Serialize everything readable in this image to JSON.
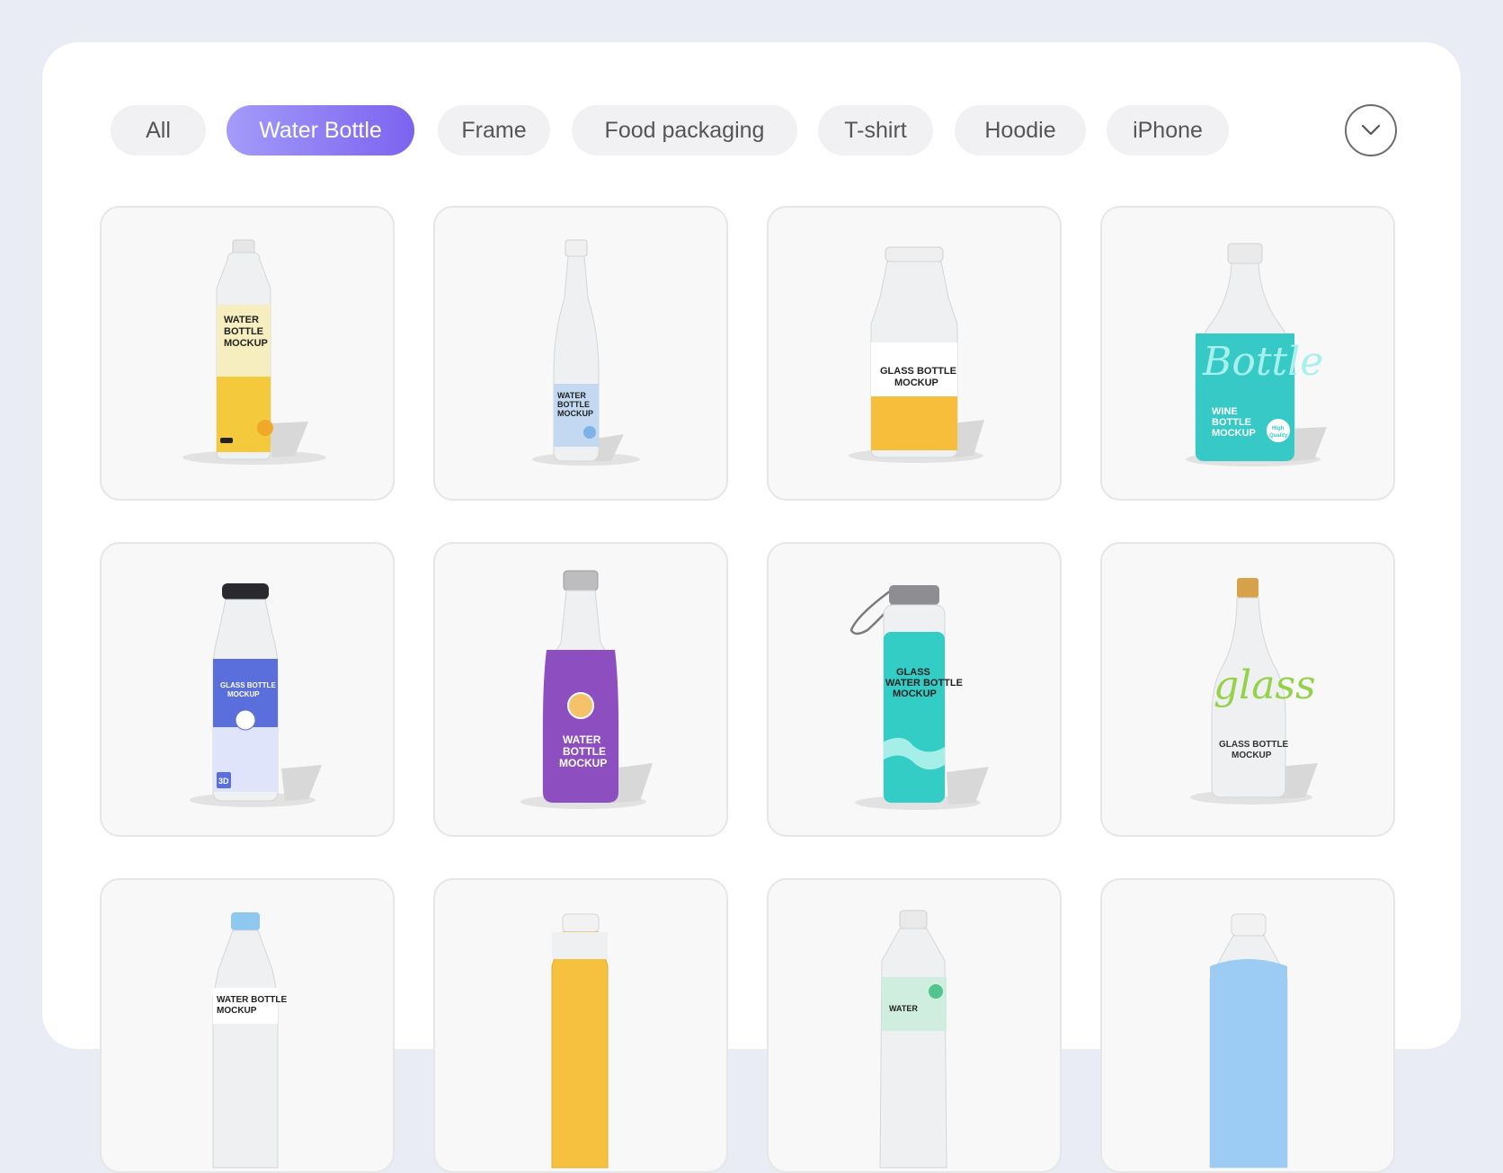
{
  "filters": {
    "chips": [
      {
        "label": "All",
        "active": false
      },
      {
        "label": "Water Bottle",
        "active": true
      },
      {
        "label": "Frame",
        "active": false
      },
      {
        "label": "Food packaging",
        "active": false
      },
      {
        "label": "T-shirt",
        "active": false
      },
      {
        "label": "Hoodie",
        "active": false
      },
      {
        "label": "iPhone",
        "active": false
      }
    ],
    "more_icon": "chevron-down-icon"
  },
  "colors": {
    "page_bg": "#e9ecf4",
    "active_chip_start": "#a49bfa",
    "active_chip_end": "#7c63ef",
    "chip_bg": "#f1f1f3"
  },
  "cards": [
    {
      "label_lines": [
        "WATER",
        "BOTTLE",
        "MOCKUP"
      ]
    },
    {
      "label_lines": [
        "WATER",
        "BOTTLE",
        "MOCKUP"
      ]
    },
    {
      "label_lines": [
        "GLASS BOTTLE",
        "MOCKUP"
      ]
    },
    {
      "script_text": "Bottle",
      "label_lines": [
        "WINE",
        "BOTTLE",
        "MOCKUP"
      ],
      "badge": [
        "High",
        "Quality"
      ]
    },
    {
      "label_lines": [
        "GLASS BOTTLE",
        "MOCKUP"
      ],
      "badge_label": "3D"
    },
    {
      "label_lines": [
        "WATER",
        "BOTTLE",
        "MOCKUP"
      ]
    },
    {
      "label_lines": [
        "GLASS",
        "WATER BOTTLE",
        "MOCKUP"
      ]
    },
    {
      "script_text": "glass",
      "label_lines": [
        "GLASS BOTTLE",
        "MOCKUP"
      ]
    },
    {
      "label_lines": [
        "WATER BOTTLE",
        "MOCKUP"
      ]
    },
    {
      "label_lines": []
    },
    {
      "label_lines": [
        "WATER"
      ]
    },
    {
      "label_lines": []
    }
  ]
}
